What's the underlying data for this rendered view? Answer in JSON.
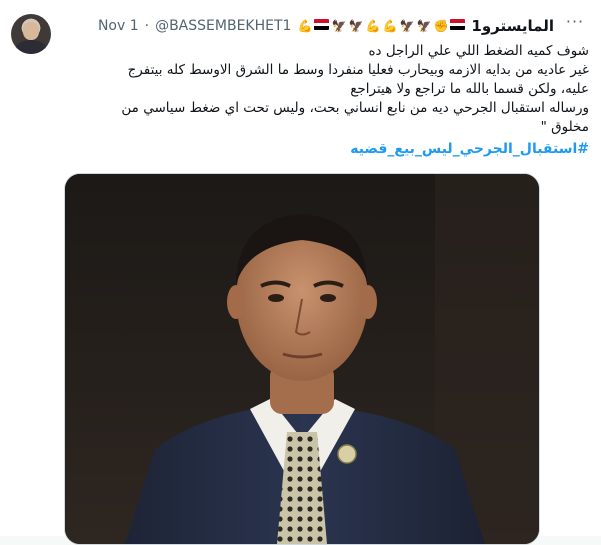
{
  "tweet": {
    "display_name": "المايسترو1",
    "handle": "@BASSEMBEKHET1",
    "separator": "·",
    "date": "Nov 1",
    "more_label": "···",
    "lines": [
      "شوف كميه الضغط اللي علي الراجل ده",
      "غير عاديه من بدايه الازمه وبيحارب فعليا منفردا وسط ما الشرق الاوسط كله بيتفرج",
      "عليه، ولكن قسما بالله ما تراجع ولا هيتراجع",
      "ورساله استقبال الجرحي ديه من نابع انساني بحت، وليس تحت اي ضغط سياسي من",
      "مخلوق \""
    ],
    "hashtag": "#استقبال_الجرحي_ليس_بيع_قضيه",
    "emoji_icons": [
      "flexed-biceps-icon",
      "egypt-flag-icon",
      "eagle-icon",
      "eagle-icon",
      "flexed-biceps-icon",
      "flexed-biceps-icon",
      "eagle-icon",
      "eagle-icon",
      "raised-fist-icon",
      "egypt-flag-icon"
    ]
  },
  "colors": {
    "link": "#1d9bf0",
    "secondary_text": "#536471",
    "flag_red": "#ce1126",
    "flag_white": "#ffffff",
    "flag_black": "#000000"
  }
}
